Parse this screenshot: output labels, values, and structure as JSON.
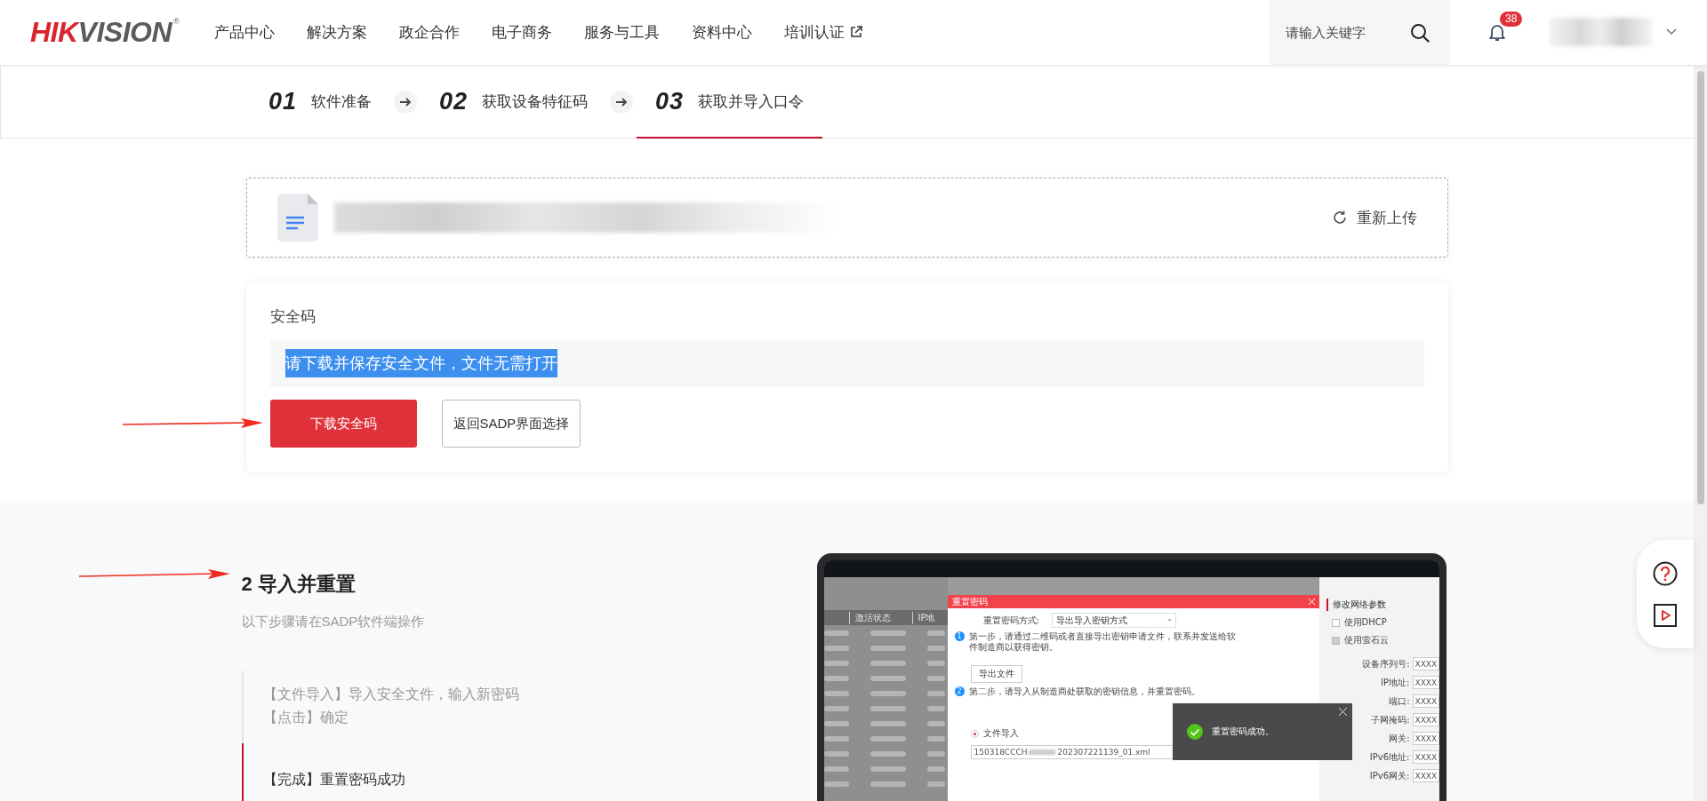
{
  "header": {
    "logo_parts": [
      {
        "text": "HIK",
        "color": "#d7262d"
      },
      {
        "text": "VISION",
        "color": "#5a5b5e"
      }
    ],
    "logo_mark": "®",
    "nav": [
      {
        "label": "产品中心",
        "external": false
      },
      {
        "label": "解决方案",
        "external": false
      },
      {
        "label": "政企合作",
        "external": false
      },
      {
        "label": "电子商务",
        "external": false
      },
      {
        "label": "服务与工具",
        "external": false
      },
      {
        "label": "资料中心",
        "external": false
      },
      {
        "label": "培训认证",
        "external": true
      }
    ],
    "search": {
      "placeholder": "请输入关键字"
    },
    "notifications": {
      "count": "38"
    }
  },
  "steps": [
    {
      "number": "01",
      "label": "软件准备",
      "selected": false
    },
    {
      "number": "02",
      "label": "获取设备特征码",
      "selected": false
    },
    {
      "number": "03",
      "label": "获取并导入口令",
      "selected": true
    }
  ],
  "upload": {
    "action": "重新上传"
  },
  "security": {
    "label": "安全码",
    "value": "请下载并保存安全文件，文件无需打开",
    "highlighted": true,
    "buttons": [
      {
        "label": "下载安全码",
        "kind": "primary"
      },
      {
        "label": "返回SADP界面选择",
        "kind": "secondary"
      }
    ]
  },
  "import": {
    "title": "2 导入并重置",
    "subtitle": "以下步骤请在SADP软件端操作",
    "steps": [
      {
        "lines": [
          "【文件导入】导入安全文件，输入新密码",
          "【点击】确定"
        ],
        "selected": false
      },
      {
        "lines": [
          "【完成】重置密码成功"
        ],
        "selected": true
      }
    ],
    "device_screenshot": {
      "table_columns": [
        "激活状态",
        "IP地"
      ],
      "dialog": {
        "title": "重置密码",
        "method_label": "重置密码方式:",
        "method_value": "导出导入密钥方式",
        "step1": {
          "number": "1",
          "text": "第一步，请通过二维码或者直接导出密钥申请文件，联系并发送给软件制造商以获得密钥。"
        },
        "export_button": "导出文件",
        "step2": {
          "number": "2",
          "text": "第二步，请导入从制造商处获取的密钥信息，并重置密码。"
        },
        "file_import": {
          "label": "文件导入",
          "selected": true,
          "file_start": "150318CCCH",
          "file_end": "202307221139_01.xml"
        }
      },
      "toast": "重置密码成功。",
      "panel": {
        "title": "修改网络参数",
        "options": [
          {
            "label": "使用DHCP",
            "checked": false,
            "disabled": false
          },
          {
            "label": "使用萤石云",
            "checked": false,
            "disabled": true
          }
        ],
        "fields": [
          {
            "label": "设备序列号:",
            "value": "XXXX"
          },
          {
            "label": "IP地址:",
            "value": "XXXX"
          },
          {
            "label": "端口:",
            "value": "XXXX"
          },
          {
            "label": "子网掩码:",
            "value": "XXXX"
          },
          {
            "label": "网关:",
            "value": "XXXX"
          },
          {
            "label": "IPv6地址:",
            "value": "XXXX"
          },
          {
            "label": "IPv6网关:",
            "value": "XXXX"
          }
        ]
      }
    }
  }
}
